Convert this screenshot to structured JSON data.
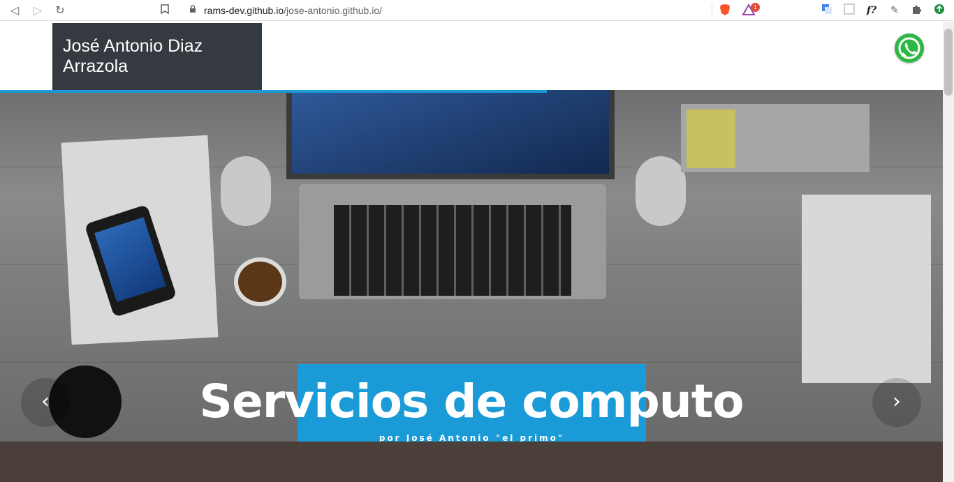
{
  "browser": {
    "url_host": "rams-dev.github.io",
    "url_path": "/jose-antonio.github.io/",
    "ext_count": "1",
    "ext_fquery": "f?"
  },
  "header": {
    "brand_line1": "José Antonio Diaz",
    "brand_line2": "Arrazola",
    "progress_fraction": 0.58
  },
  "hero": {
    "title": "Servicios de computo",
    "subtitle": "por José Antonio \"el primo\""
  },
  "colors": {
    "accent": "#1a9ad6",
    "brand_bg": "#343a40",
    "whatsapp": "#2fb745"
  },
  "icons": {
    "back": "back-arrow-icon",
    "forward": "forward-arrow-icon",
    "reload": "reload-icon",
    "bookmark": "bookmark-icon",
    "lock": "lock-icon",
    "whatsapp": "whatsapp-icon",
    "prev": "chevron-left-icon",
    "next": "chevron-right-icon"
  }
}
